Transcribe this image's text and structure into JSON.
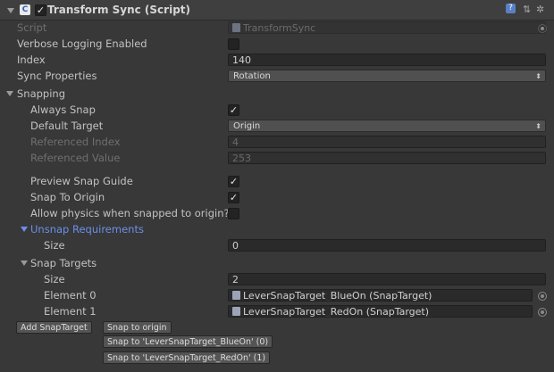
{
  "header": {
    "title": "Transform Sync (Script)",
    "enabled": true,
    "help_icon": "help-icon",
    "preset_icon": "preset-icon",
    "settings_icon": "gear-icon"
  },
  "script": {
    "label": "Script",
    "value": "TransformSync"
  },
  "verbose": {
    "label": "Verbose Logging Enabled",
    "checked": false
  },
  "index": {
    "label": "Index",
    "value": "140"
  },
  "sync_properties": {
    "label": "Sync Properties",
    "value": "Rotation"
  },
  "snapping": {
    "label": "Snapping",
    "always_snap": {
      "label": "Always Snap",
      "checked": true
    },
    "default_target": {
      "label": "Default Target",
      "value": "Origin"
    },
    "referenced_index": {
      "label": "Referenced Index",
      "value": "4"
    },
    "referenced_value": {
      "label": "Referenced Value",
      "value": "253"
    },
    "preview_snap_guide": {
      "label": "Preview Snap Guide",
      "checked": true
    },
    "snap_to_origin": {
      "label": "Snap To Origin",
      "checked": true
    },
    "allow_physics": {
      "label": "Allow physics when snapped to origin?",
      "checked": false
    },
    "unsnap": {
      "label": "Unsnap Requirements",
      "size_label": "Size",
      "size_value": "0"
    },
    "snap_targets": {
      "label": "Snap Targets",
      "size_label": "Size",
      "size_value": "2",
      "elements": [
        {
          "label": "Element 0",
          "value": "LeverSnapTarget_BlueOn (SnapTarget)"
        },
        {
          "label": "Element 1",
          "value": "LeverSnapTarget_RedOn (SnapTarget)"
        }
      ]
    }
  },
  "buttons": {
    "add_snap_target": "Add SnapTarget",
    "snap_to_origin": "Snap to origin",
    "snap_to_blue": "Snap to 'LeverSnapTarget_BlueOn' (0)",
    "snap_to_red": "Snap to 'LeverSnapTarget_RedOn' (1)"
  },
  "colors": {
    "background": "#383838",
    "header": "#3f3f3f",
    "accent_blue": "#6b8fe8",
    "field": "#2a2a2a"
  }
}
